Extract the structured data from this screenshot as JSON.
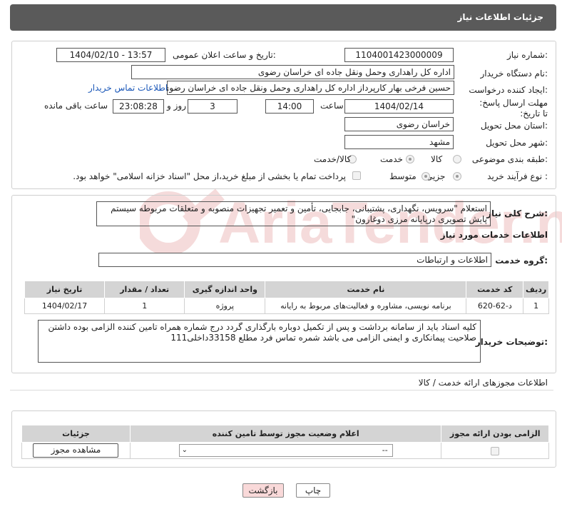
{
  "header": {
    "title": "جزئیات اطلاعات نیاز"
  },
  "form": {
    "need_number_label": "شماره نیاز:",
    "need_number": "1104001423000009",
    "announce_label": "تاریخ و ساعت اعلان عمومی:",
    "announce_value": "1404/02/10 - 13:57",
    "buyer_org_label": "نام دستگاه خریدار:",
    "buyer_org": "اداره کل راهداری وحمل ونقل جاده ای خراسان رضوی",
    "creator_label": "ایجاد کننده درخواست:",
    "creator": "حسین فرخی بهار کارپرداز اداره کل راهداری وحمل ونقل جاده ای خراسان رضوی",
    "contact_link": "اطلاعات تماس خریدار",
    "deadline_label": "مهلت ارسال پاسخ: تا تاریخ:",
    "deadline_date": "1404/02/14",
    "time_label": "ساعت",
    "deadline_time": "14:00",
    "days_value": "3",
    "days_label": "روز و",
    "remaining_time": "23:08:28",
    "remaining_label": "ساعت باقی مانده",
    "province_label": "استان محل تحویل:",
    "province": "خراسان رضوی",
    "city_label": "شهر محل تحویل:",
    "city": "مشهد",
    "category_label": "طبقه بندی موضوعی:",
    "category_options": [
      "کالا",
      "خدمت",
      "کالا/خدمت"
    ],
    "category_selected": "خدمت",
    "process_label": "نوع فرآیند خرید :",
    "process_options": [
      "جزیی",
      "متوسط"
    ],
    "process_selected": "جزیی",
    "treasury_note": "پرداخت تمام یا بخشی از مبلغ خرید،از محل \"اسناد خزانه اسلامی\" خواهد بود."
  },
  "summary": {
    "label": "شرح کلی نیاز:",
    "text": "استعلام \"سرویس، نگهداری، پشتیبانی، جابجایی، تأمین و تعمیر تجهیزات منصوبه و متعلقات مربوطه سیستم پایش تصویری درپایانه مرزی دوغارون\"",
    "services_title": "اطلاعات خدمات مورد نیاز",
    "group_label": "گروه خدمت:",
    "group_value": "اطلاعات و ارتباطات"
  },
  "services_table": {
    "headers": [
      "ردیف",
      "کد خدمت",
      "نام خدمت",
      "واحد اندازه گیری",
      "تعداد / مقدار",
      "تاریخ نیاز"
    ],
    "rows": [
      [
        "1",
        "د-62-620",
        "برنامه نویسی، مشاوره و فعالیت‌های مربوط به رایانه",
        "پروژه",
        "1",
        "1404/02/17"
      ]
    ]
  },
  "buyer_notes": {
    "label": "توضیحات خریدار:",
    "text": "کلیه اسناد باید از سامانه برداشت و پس از تکمیل دوباره بارگذاری گردد درج شماره همراه تامین کننده الزامی بوده داشتن صلاحیت پیمانکاری و ایمنی الزامی می باشد  شمره تماس فرد مطلع  33158داخلی111"
  },
  "permits": {
    "section_title": "اطلاعات مجوزهای ارائه خدمت / کالا",
    "headers": [
      "الزامی بودن ارائه مجوز",
      "اعلام وضعیت مجوز توسط تامین کننده",
      "جزئیات"
    ],
    "select_value": "--",
    "view_button": "مشاهده مجوز"
  },
  "footer": {
    "print_button": "چاپ",
    "back_button": "بازگشت"
  },
  "watermark": {
    "text": "AriaTender.neT"
  },
  "colors": {
    "title_bar": "#5a5a5a",
    "link": "#1a57b8",
    "back_button_bg": "#f9d9d9",
    "watermark": "#c62828"
  }
}
